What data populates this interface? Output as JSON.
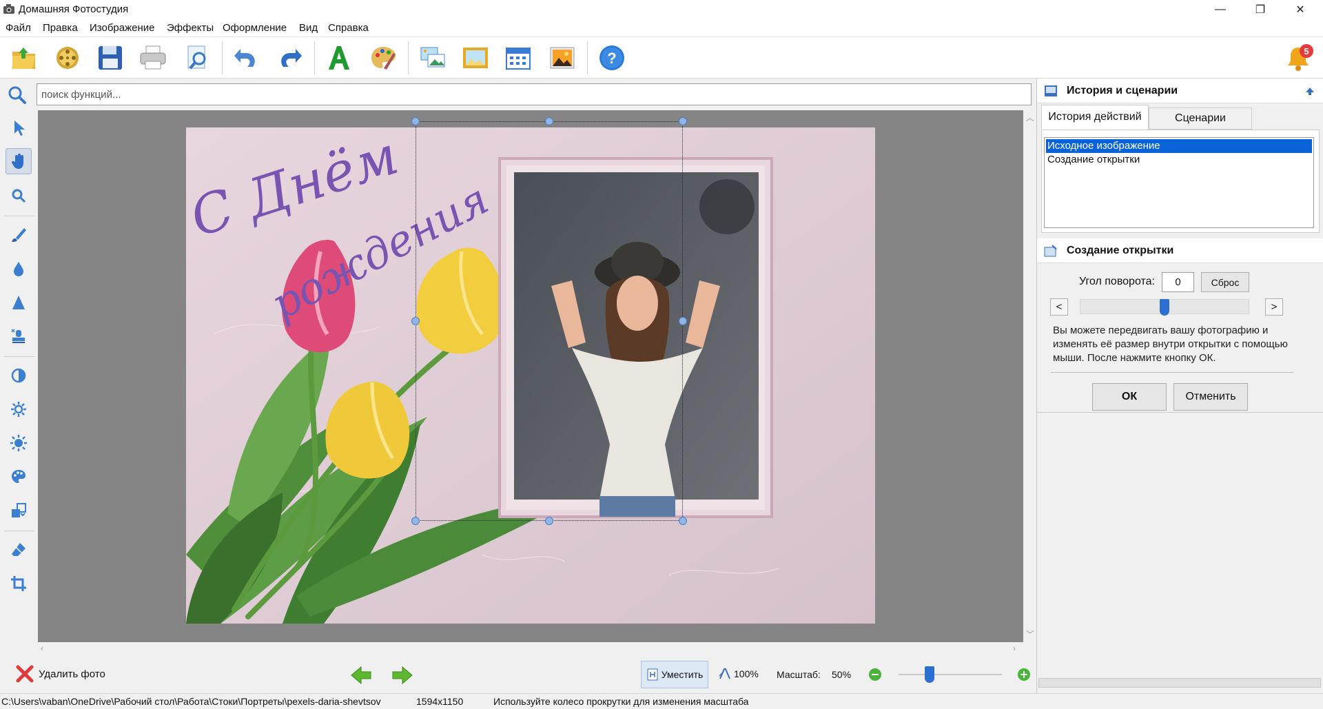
{
  "window": {
    "title": "Домашняя Фотостудия",
    "controls": {
      "minimize": "—",
      "maximize": "❐",
      "close": "✕"
    }
  },
  "menu": [
    "Файл",
    "Правка",
    "Изображение",
    "Эффекты",
    "Оформление",
    "Вид",
    "Справка"
  ],
  "toolbar": {
    "icons": [
      "open-folder-icon",
      "film-reel-icon",
      "save-disk-icon",
      "printer-icon",
      "preview-magnifier-icon",
      "undo-icon",
      "redo-icon",
      "text-a-icon",
      "palette-brush-icon",
      "collage-icon",
      "frame-icon",
      "calendar-icon",
      "postcard-icon",
      "help-icon"
    ],
    "notification_count": "5"
  },
  "search": {
    "placeholder": "поиск функций..."
  },
  "left_tools": [
    "pointer-icon",
    "hand-icon",
    "zoom-icon",
    "brush-icon",
    "blur-drop-icon",
    "sharpen-triangle-icon",
    "stamp-icon",
    "contrast-icon",
    "brightness-icon",
    "light-icon",
    "color-palette-icon",
    "replace-icon",
    "eraser-icon",
    "crop-icon"
  ],
  "card": {
    "greeting_line1": "С Днём",
    "greeting_line2": "рождения"
  },
  "right_panel": {
    "history_header": "История и сценарии",
    "tabs": [
      "История действий",
      "Сценарии"
    ],
    "history_items": [
      "Исходное изображение",
      "Создание открытки"
    ],
    "card_section": {
      "title": "Создание открытки",
      "angle_label": "Угол поворота:",
      "angle_value": "0",
      "reset_label": "Сброс",
      "prev": "<",
      "next": ">",
      "slider_position": 0.5,
      "hint": "Вы можете передвигать вашу фотографию и изменять её размер внутри открытки с помощью мыши. После нажмите кнопку ОК.",
      "ok_label": "ОК",
      "cancel_label": "Отменить"
    }
  },
  "bottom": {
    "delete_photo": "Удалить фото",
    "fit_label": "Уместить",
    "actual_label": "100%",
    "scale_label": "Масштаб:",
    "scale_value": "50%",
    "zoom_slider_position": 0.3
  },
  "status": {
    "path": "C:\\Users\\vaban\\OneDrive\\Рабочий стол\\Работа\\Стоки\\Портреты\\pexels-daria-shevtsov",
    "dimensions": "1594x1150",
    "hint": "Используйте колесо прокрутки для изменения масштаба"
  },
  "colors": {
    "selection": "#0a64d8",
    "accent": "#2b6fd0",
    "card_bg": "#e3d1d9"
  }
}
